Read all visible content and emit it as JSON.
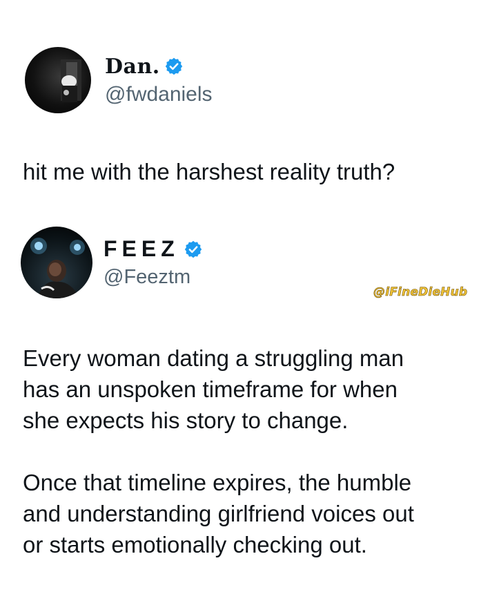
{
  "tweets": [
    {
      "display_name": "Dan.",
      "handle": "@fwdaniels",
      "verified": true,
      "text": "hit me with the harshest reality truth?"
    },
    {
      "display_name": "FEEZ",
      "handle": "@Feeztm",
      "verified": true,
      "text": "Every woman dating a struggling man\nhas an unspoken timeframe for when\nshe expects his story to change.\n\nOnce that timeline expires, the humble\nand  understanding girlfriend voices out\nor starts emotionally checking out."
    }
  ],
  "watermark": "@iFineDieHub",
  "colors": {
    "verified_badge": "#1d9bf0",
    "text": "#0f1419",
    "handle": "#536471",
    "watermark": "#f2c53a"
  },
  "icons": {
    "verified": "verified-badge-icon"
  }
}
